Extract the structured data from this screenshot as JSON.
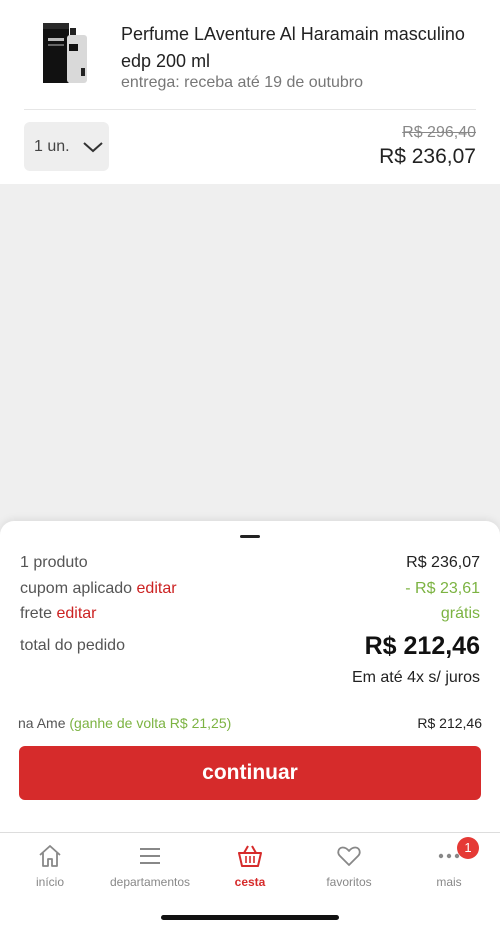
{
  "product": {
    "title": "Perfume LAventure Al Haramain masculino edp 200 ml",
    "delivery": "entrega: receba até 19 de outubro",
    "quantity": "1 un.",
    "old_price": "R$ 296,40",
    "price": "R$ 236,07"
  },
  "summary": {
    "products_label": "1 produto",
    "products_value": "R$ 236,07",
    "coupon_label": "cupom aplicado",
    "coupon_edit": "editar",
    "coupon_value": "- R$ 23,61",
    "shipping_label": "frete",
    "shipping_edit": "editar",
    "shipping_value": "grátis",
    "total_label": "total do pedido",
    "total_value": "R$ 212,46",
    "installments": "Em até 4x s/ juros",
    "ame_label": "na Ame",
    "ame_cashback": "(ganhe de volta R$ 21,25)",
    "ame_value": "R$ 212,46",
    "continue_label": "continuar"
  },
  "tabs": [
    {
      "label": "início",
      "icon": "home-icon"
    },
    {
      "label": "departamentos",
      "icon": "menu-icon"
    },
    {
      "label": "cesta",
      "icon": "basket-icon",
      "active": true
    },
    {
      "label": "favoritos",
      "icon": "heart-icon"
    },
    {
      "label": "mais",
      "icon": "more-icon",
      "badge": "1"
    }
  ],
  "colors": {
    "accent": "#d62b2b",
    "discount_green": "#7cb342",
    "badge": "#e53935"
  }
}
